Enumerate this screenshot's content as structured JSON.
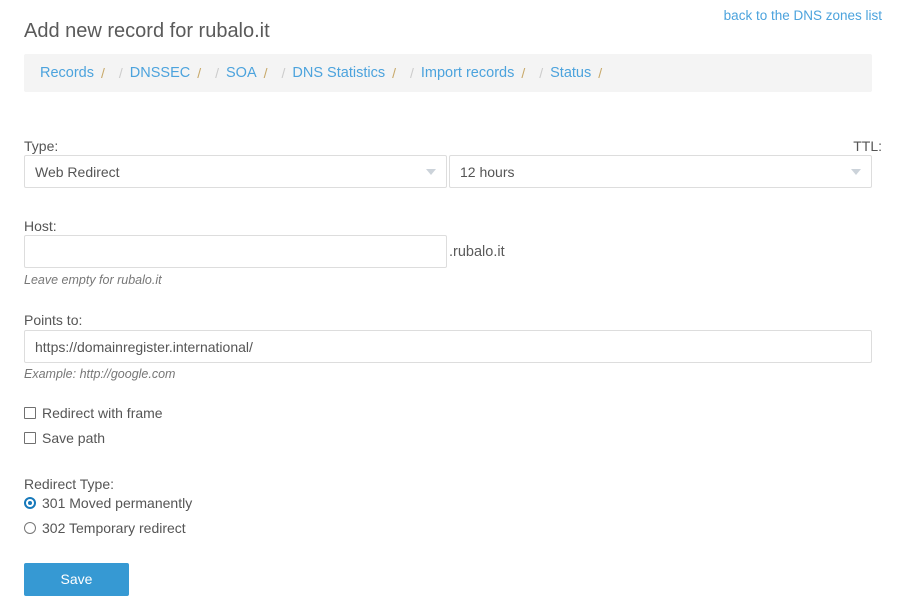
{
  "header": {
    "title": "Add new record for rubalo.it",
    "back_link": "back to the DNS zones list"
  },
  "breadcrumb": {
    "separator": "/",
    "items": [
      {
        "label": "Records"
      },
      {
        "label": "DNSSEC"
      },
      {
        "label": "SOA"
      },
      {
        "label": "DNS Statistics"
      },
      {
        "label": "Import records"
      },
      {
        "label": "Status"
      }
    ]
  },
  "form": {
    "type": {
      "label": "Type:",
      "value": "Web Redirect"
    },
    "ttl": {
      "label": "TTL:",
      "value": "12 hours"
    },
    "host": {
      "label": "Host:",
      "value": "",
      "placeholder": "",
      "suffix": ".rubalo.it",
      "hint": "Leave empty for rubalo.it"
    },
    "points_to": {
      "label": "Points to:",
      "value": "https://domainregister.international/",
      "placeholder": "",
      "hint": "Example: http://google.com"
    },
    "options": [
      {
        "label": "Redirect with frame",
        "checked": false
      },
      {
        "label": "Save path",
        "checked": false
      }
    ],
    "redirect_type": {
      "label": "Redirect Type:",
      "options": [
        {
          "label": "301 Moved permanently",
          "selected": true
        },
        {
          "label": "302 Temporary redirect",
          "selected": false
        }
      ]
    },
    "save_button": "Save"
  },
  "colors": {
    "link": "#4ca3dd",
    "accent": "#3699d3",
    "radio_selected": "#1779ba",
    "breadcrumb_bg": "#f4f4f4",
    "text": "#555555",
    "border": "#dddddd"
  }
}
